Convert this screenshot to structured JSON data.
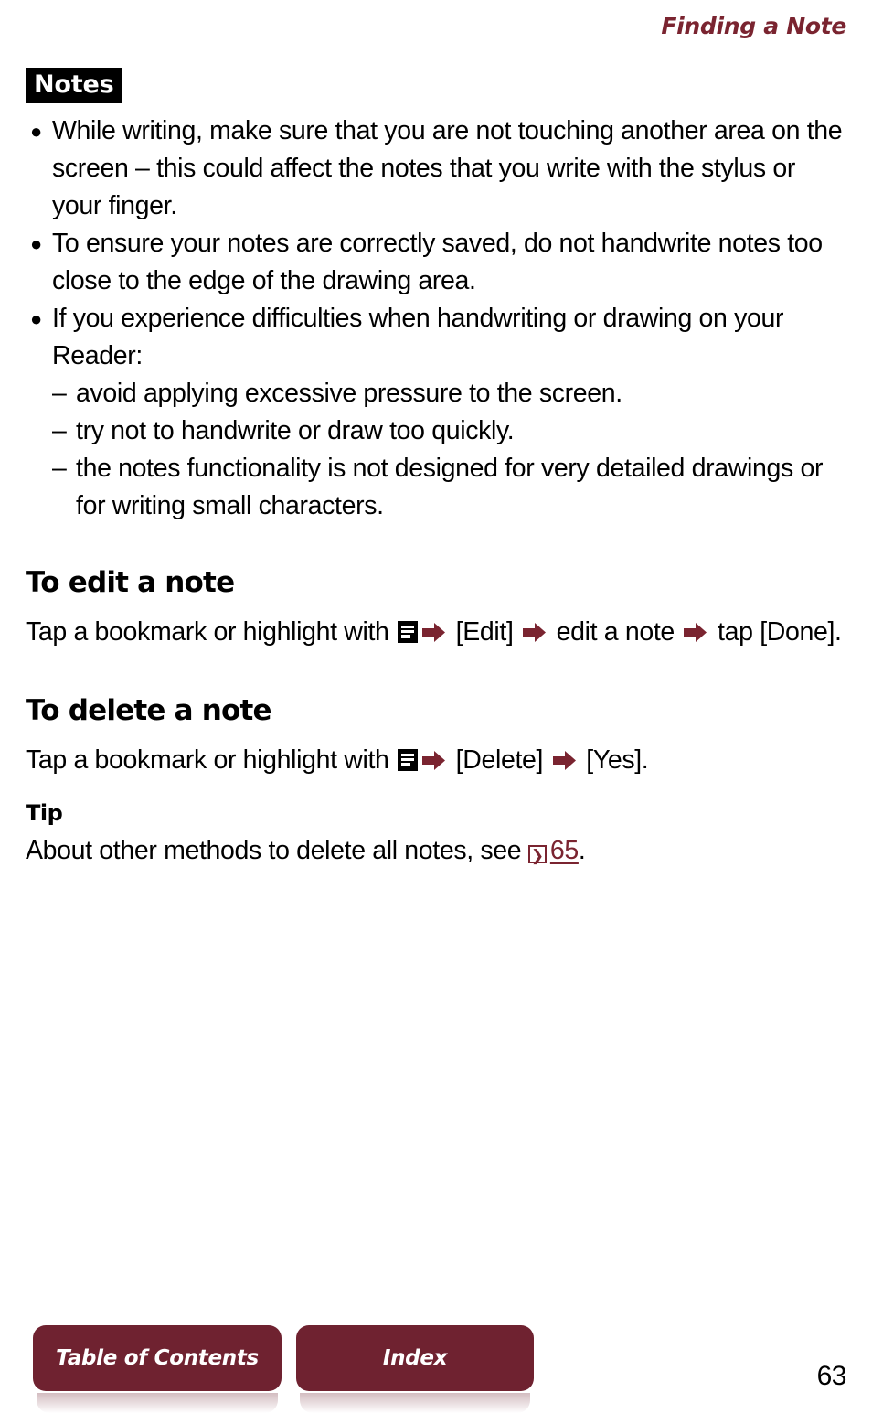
{
  "header": {
    "running_title": "Finding a Note",
    "accent_color": "#7A2430"
  },
  "callout": {
    "label": "Notes",
    "bullets": [
      "While writing, make sure that you are not touching another area on the screen – this could affect the notes that you write with the stylus or your finger.",
      "To ensure your notes are correctly saved, do not handwrite notes too close to the edge of the drawing area.",
      "If you experience difficulties when handwriting or drawing on your Reader:"
    ],
    "sub_items": [
      "avoid applying excessive pressure to the screen.",
      "try not to handwrite or draw too quickly.",
      "the notes functionality is not designed for very detailed drawings or for writing small characters."
    ],
    "bullet_glyph": "●",
    "dash_glyph": "–"
  },
  "sections": {
    "edit": {
      "heading": "To edit a note",
      "text_part_1": "Tap a bookmark or highlight with ",
      "text_part_2": " [Edit] ",
      "text_part_3": " edit a note ",
      "text_part_4": " tap [Done]."
    },
    "delete": {
      "heading": "To delete a note",
      "text_part_1": "Tap a bookmark or highlight with ",
      "text_part_2": " [Delete] ",
      "text_part_3": " [Yes]."
    },
    "tip": {
      "heading": "Tip",
      "text_part_1": "About other methods to delete all notes, see ",
      "ref_icon_glyph": "➤",
      "ref_page": "65",
      "text_part_2": "."
    }
  },
  "icons": {
    "menu_icon_name": "options-menu-icon",
    "arrow_icon_name": "right-arrow-icon",
    "ref_icon_name": "page-reference-icon",
    "arrow_color": "#7A2430"
  },
  "footer": {
    "table_of_contents_label": "Table of Contents",
    "index_label": "Index",
    "page_number": "63",
    "button_color": "#6F2230"
  }
}
